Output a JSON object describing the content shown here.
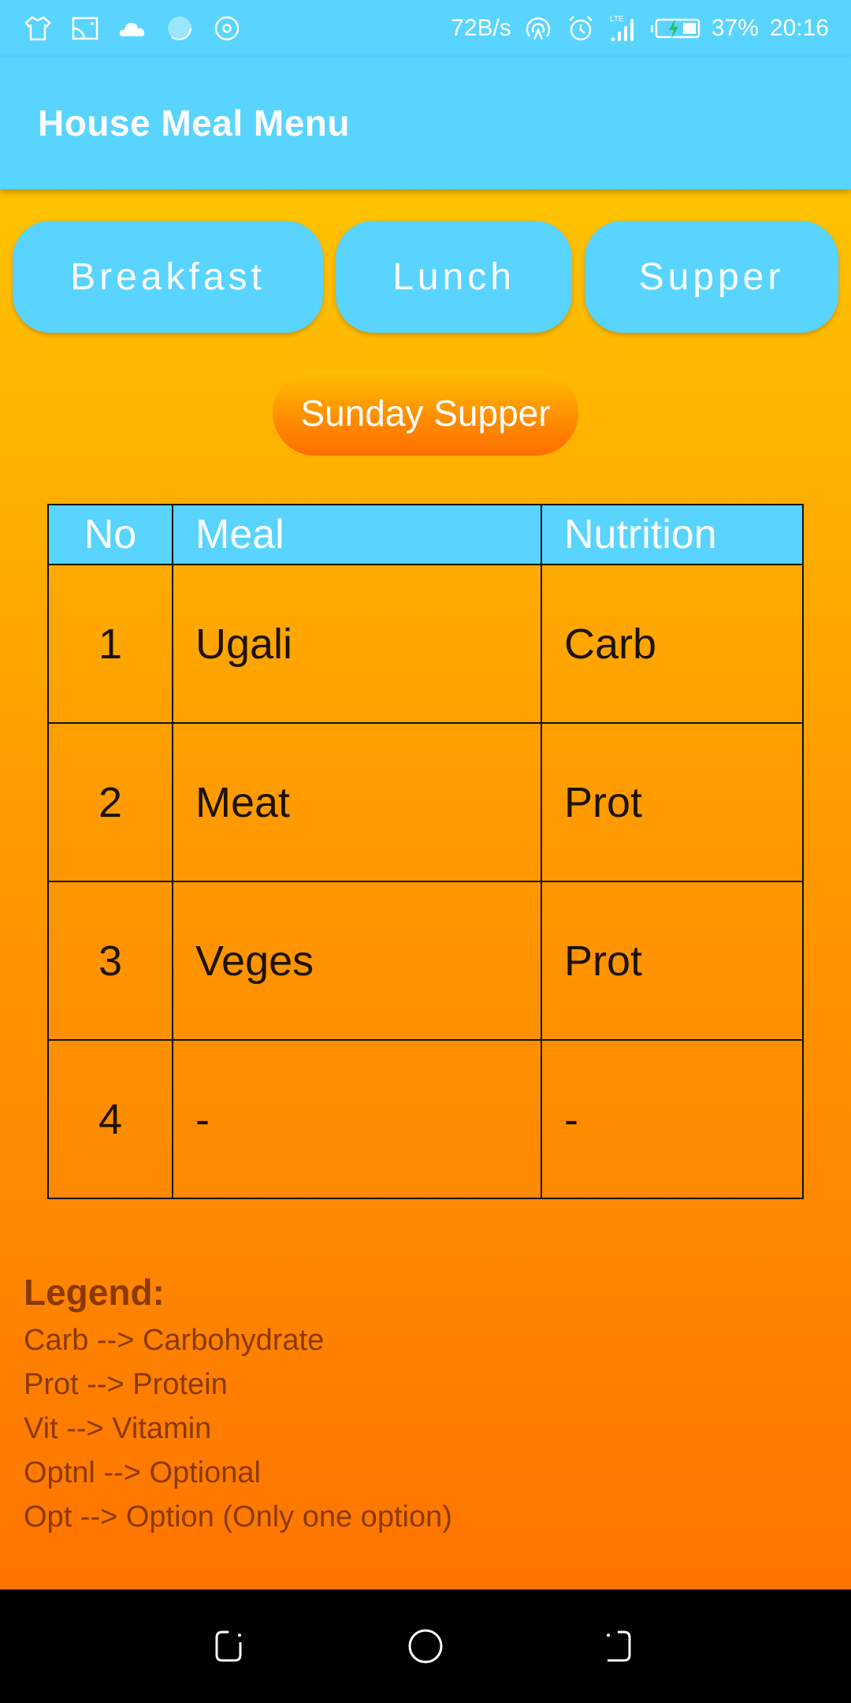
{
  "status_bar": {
    "left_icons": [
      "tshirt-icon",
      "cast-icon",
      "cloud-icon",
      "loading-circle-icon",
      "target-icon"
    ],
    "network_speed": "72B/s",
    "network_type": "LTE",
    "battery_percent": "37%",
    "time": "20:16"
  },
  "app_bar": {
    "title": "House Meal Menu"
  },
  "meal_tabs": [
    {
      "label": "Breakfast"
    },
    {
      "label": "Lunch"
    },
    {
      "label": "Supper"
    }
  ],
  "day_badge": "Sunday Supper",
  "table": {
    "headers": [
      "No",
      "Meal",
      "Nutrition"
    ],
    "rows": [
      {
        "no": "1",
        "meal": "Ugali",
        "nutrition": "Carb"
      },
      {
        "no": "2",
        "meal": "Meat",
        "nutrition": "Prot"
      },
      {
        "no": "3",
        "meal": "Veges",
        "nutrition": "Prot"
      },
      {
        "no": "4",
        "meal": "-",
        "nutrition": "-"
      }
    ]
  },
  "legend": {
    "title": "Legend:",
    "items": [
      "Carb --> Carbohydrate",
      "Prot --> Protein",
      "Vit --> Vitamin",
      "Optnl --> Optional",
      "Opt --> Option (Only one option)"
    ]
  },
  "colors": {
    "accent_blue": "#58d4ff",
    "gradient_top": "#ffc300",
    "gradient_bottom": "#ff7400",
    "legend_text": "#8a3a00",
    "charging_bolt": "#1fc45b"
  }
}
